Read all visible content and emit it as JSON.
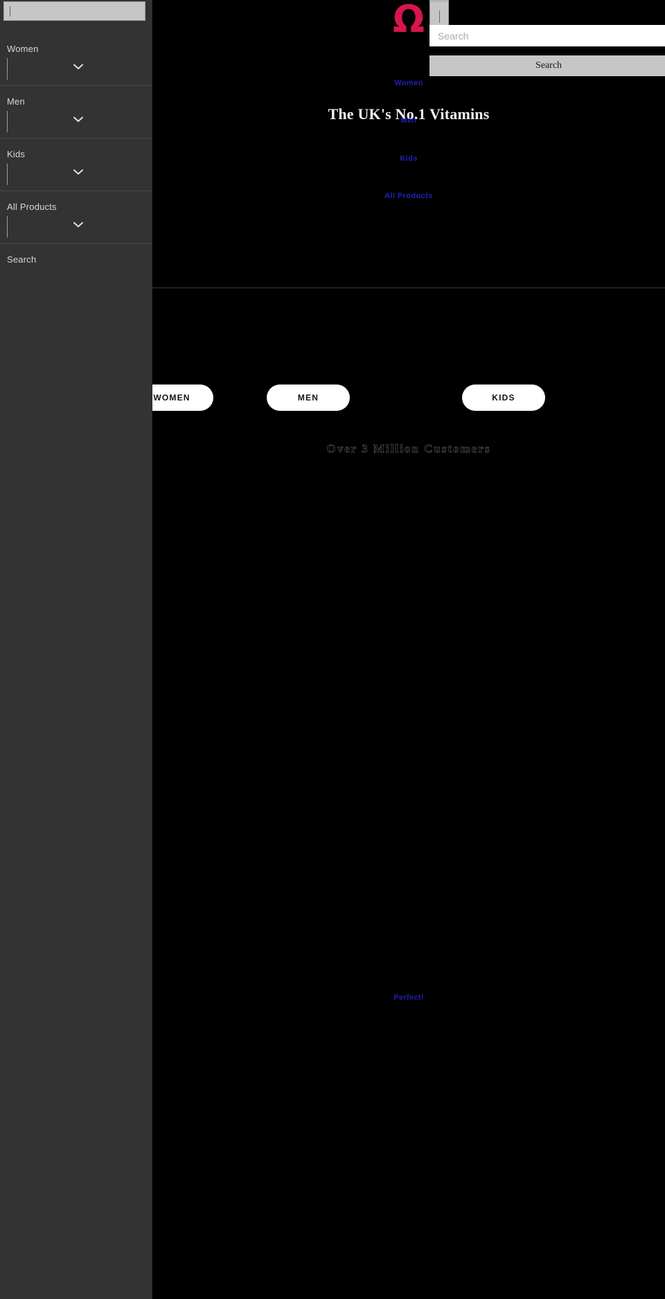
{
  "brand": {
    "logo_glyph": "Ω",
    "logo_color": "#d6164b"
  },
  "header": {
    "heading": "The UK's No.1 Vitamins",
    "links": [
      {
        "label": "Women"
      },
      {
        "label": "Men"
      },
      {
        "label": "Kids"
      },
      {
        "label": "All Products"
      }
    ],
    "link_color": "#2323c8"
  },
  "search": {
    "placeholder": "Search",
    "value": "",
    "submit_label": "Search"
  },
  "hero": {
    "pills": [
      {
        "label": "WOMEN"
      },
      {
        "label": "MEN"
      },
      {
        "label": "KIDS"
      }
    ],
    "strapline": "Over 3 Million Customers"
  },
  "footer": {
    "link_label": "Perfect!"
  },
  "drawer": {
    "search_field_value": "",
    "items": [
      {
        "label": "Women",
        "expander_icon": "chevron-down-icon"
      },
      {
        "label": "Men",
        "expander_icon": "chevron-down-icon"
      },
      {
        "label": "Kids",
        "expander_icon": "chevron-down-icon"
      },
      {
        "label": "All Products",
        "expander_icon": "chevron-down-icon"
      }
    ],
    "search_item_label": "Search"
  }
}
